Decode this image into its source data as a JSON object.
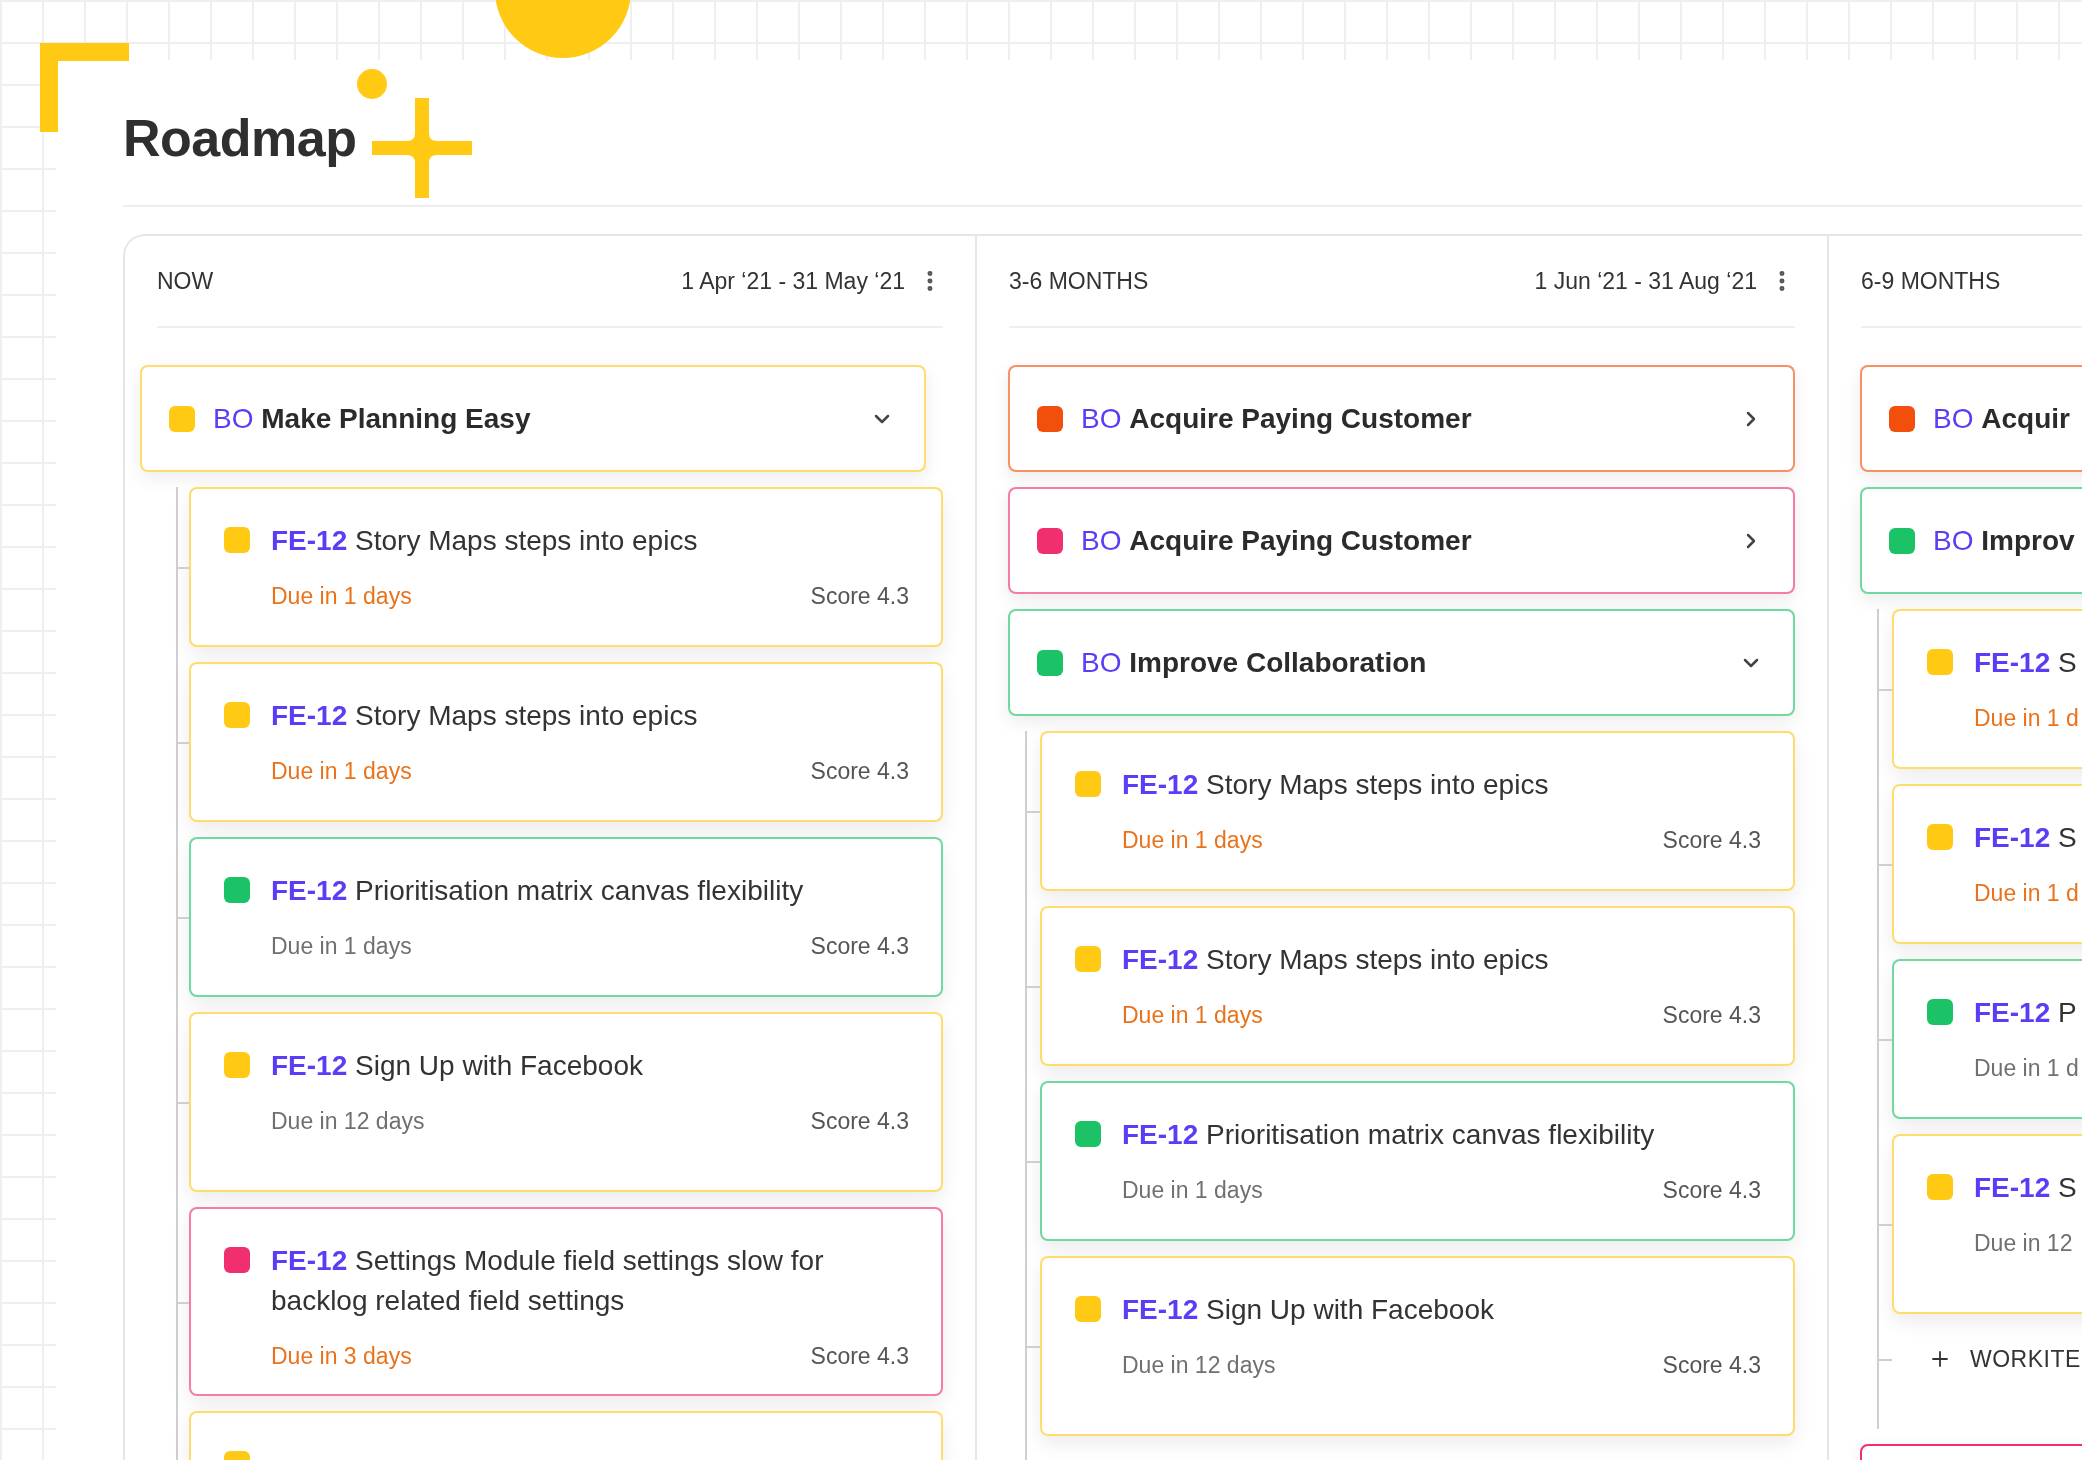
{
  "title": "Roadmap",
  "columns": [
    {
      "label": "NOW",
      "dates": "1 Apr ‘21 - 31 May ‘21",
      "objectives": [
        {
          "tag": "BO",
          "name": "Make Planning Easy",
          "color": "#ffc914",
          "expanded": true,
          "items": [
            {
              "code": "FE-12",
              "title": "Story Maps steps into epics",
              "due": "Due in 1 days",
              "urgent": true,
              "score": "Score 4.3",
              "color": "#ffc914"
            },
            {
              "code": "FE-12",
              "title": "Story Maps steps into epics",
              "due": "Due in 1 days",
              "urgent": true,
              "score": "Score 4.3",
              "color": "#ffc914"
            },
            {
              "code": "FE-12",
              "title": "Prioritisation matrix canvas flexibility",
              "due": "Due in 1 days",
              "urgent": false,
              "score": "Score 4.3",
              "color": "#1bc266"
            },
            {
              "code": "FE-12",
              "title": "Sign Up with Facebook",
              "due": "Due in 12 days",
              "urgent": false,
              "score": "Score 4.3",
              "color": "#ffc914",
              "tall": true
            },
            {
              "code": "FE-12",
              "title": "Settings Module field settings slow for backlog related  field settings",
              "due": "Due in 3 days",
              "urgent": true,
              "score": "Score 4.3",
              "color": "#ef2f6e"
            },
            {
              "color": "#ffc914"
            }
          ]
        }
      ]
    },
    {
      "label": "3-6 MONTHS",
      "dates": "1 Jun ‘21 - 31 Aug ‘21",
      "objectives": [
        {
          "tag": "BO",
          "name": "Acquire Paying Customer",
          "color": "#f24e0c",
          "expanded": false
        },
        {
          "tag": "BO",
          "name": "Acquire Paying Customer",
          "color": "#ef2f6e",
          "expanded": false
        },
        {
          "tag": "BO",
          "name": "Improve Collaboration",
          "color": "#1bc266",
          "expanded": true,
          "items": [
            {
              "code": "FE-12",
              "title": "Story Maps steps into epics",
              "due": "Due in 1 days",
              "urgent": true,
              "score": "Score 4.3",
              "color": "#ffc914"
            },
            {
              "code": "FE-12",
              "title": "Story Maps steps into epics",
              "due": "Due in 1 days",
              "urgent": true,
              "score": "Score 4.3",
              "color": "#ffc914"
            },
            {
              "code": "FE-12",
              "title": "Prioritisation matrix canvas flexibility",
              "due": "Due in 1 days",
              "urgent": false,
              "score": "Score 4.3",
              "color": "#1bc266"
            },
            {
              "code": "FE-12",
              "title": "Sign Up with Facebook",
              "due": "Due in 12 days",
              "urgent": false,
              "score": "Score 4.3",
              "color": "#ffc914",
              "tall": true
            }
          ]
        }
      ]
    },
    {
      "label": "6-9 MONTHS",
      "objectives": [
        {
          "tag": "BO",
          "name": "Acquir",
          "color": "#f24e0c"
        },
        {
          "tag": "BO",
          "name": "Improv",
          "color": "#1bc266",
          "items": [
            {
              "code": "FE-12",
              "title": "S",
              "due": "Due in 1 d",
              "urgent": true,
              "color": "#ffc914"
            },
            {
              "code": "FE-12",
              "title": "S",
              "due": "Due in 1 d",
              "urgent": true,
              "color": "#ffc914"
            },
            {
              "code": "FE-12",
              "title": "P",
              "due": "Due in 1 d",
              "urgent": false,
              "color": "#1bc266"
            },
            {
              "code": "FE-12",
              "title": "S",
              "due": "Due in 12",
              "urgent": false,
              "color": "#ffc914",
              "tall": true
            }
          ],
          "add_label": "WORKITE"
        },
        {
          "color": "#ef2f6e"
        }
      ]
    }
  ]
}
